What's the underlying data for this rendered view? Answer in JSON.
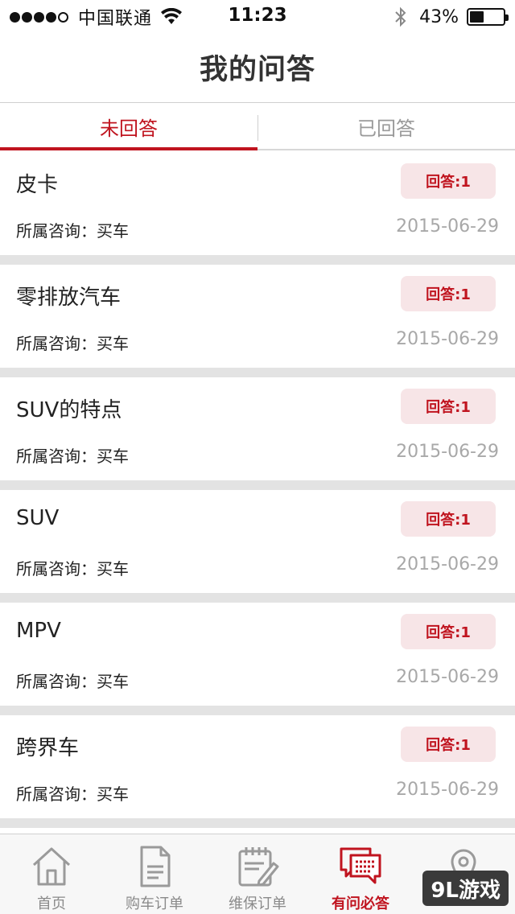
{
  "status_bar": {
    "carrier": "中国联通",
    "time": "11:23",
    "battery_percent": "43%",
    "battery_level": 0.43
  },
  "header": {
    "title": "我的问答"
  },
  "tabs": [
    {
      "label": "未回答",
      "active": true
    },
    {
      "label": "已回答",
      "active": false
    }
  ],
  "questions": [
    {
      "title": "皮卡",
      "answers": "回答:1",
      "category": "所属咨询：买车",
      "date": "2015-06-29"
    },
    {
      "title": "零排放汽车",
      "answers": "回答:1",
      "category": "所属咨询：买车",
      "date": "2015-06-29"
    },
    {
      "title": "SUV的特点",
      "answers": "回答:1",
      "category": "所属咨询：买车",
      "date": "2015-06-29"
    },
    {
      "title": "SUV",
      "answers": "回答:1",
      "category": "所属咨询：买车",
      "date": "2015-06-29"
    },
    {
      "title": "MPV",
      "answers": "回答:1",
      "category": "所属咨询：买车",
      "date": "2015-06-29"
    },
    {
      "title": "跨界车",
      "answers": "回答:1",
      "category": "所属咨询：买车",
      "date": "2015-06-29"
    }
  ],
  "tabbar": {
    "items": [
      {
        "label": "首页",
        "icon": "home-icon",
        "active": false
      },
      {
        "label": "购车订单",
        "icon": "document-icon",
        "active": false
      },
      {
        "label": "维保订单",
        "icon": "calendar-edit-icon",
        "active": false
      },
      {
        "label": "有问必答",
        "icon": "chat-bubbles-icon",
        "active": true
      },
      {
        "label": "",
        "icon": "location-pin-icon",
        "active": false
      }
    ]
  },
  "watermark": {
    "text": "9L游戏"
  },
  "colors": {
    "accent": "#c0141f",
    "badge_bg": "#f7e5e7",
    "separator": "#e3e3e3",
    "muted": "#a8a8a8"
  }
}
